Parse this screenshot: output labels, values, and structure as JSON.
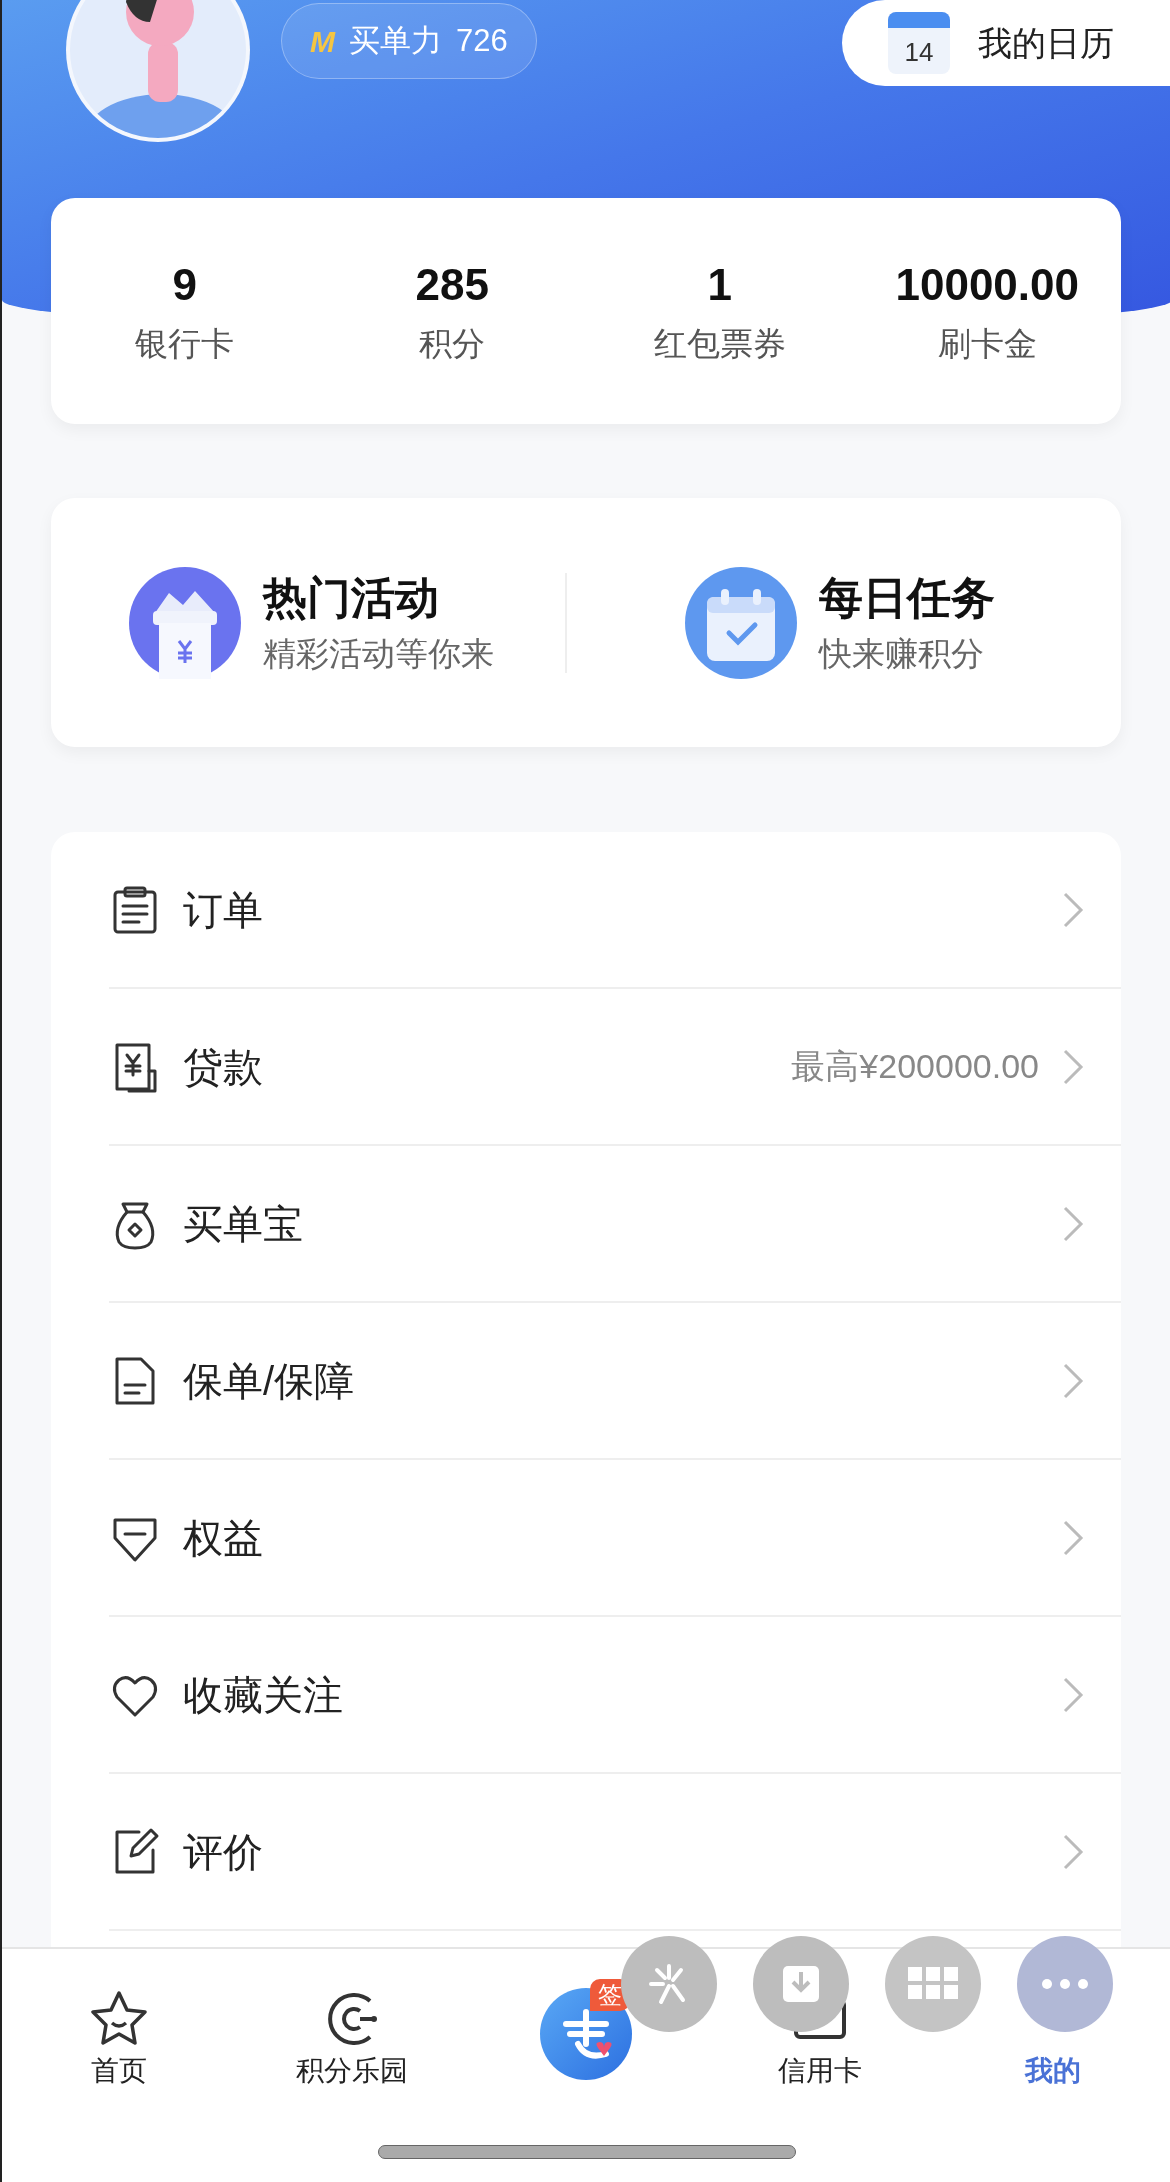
{
  "header": {
    "buy_power": {
      "logo": "M",
      "label": "买单力",
      "value": "726"
    },
    "calendar": {
      "day": "14",
      "label": "我的日历"
    }
  },
  "stats": [
    {
      "value": "9",
      "label": "银行卡"
    },
    {
      "value": "285",
      "label": "积分"
    },
    {
      "value": "1",
      "label": "红包票券"
    },
    {
      "value": "10000.00",
      "label": "刷卡金"
    }
  ],
  "activities": [
    {
      "kind": "hot",
      "title": "热门活动",
      "subtitle": "精彩活动等你来"
    },
    {
      "kind": "task",
      "title": "每日任务",
      "subtitle": "快来赚积分"
    }
  ],
  "menu": [
    {
      "kind": "order",
      "label": "订单"
    },
    {
      "kind": "loan",
      "label": "贷款",
      "note": "最高¥200000.00"
    },
    {
      "kind": "bag",
      "label": "买单宝"
    },
    {
      "kind": "doc",
      "label": "保单/保障"
    },
    {
      "kind": "gem",
      "label": "权益"
    },
    {
      "kind": "heart",
      "label": "收藏关注"
    },
    {
      "kind": "edit",
      "label": "评价"
    }
  ],
  "tab_bar": [
    {
      "kind": "home",
      "label": "首页",
      "selected": false
    },
    {
      "kind": "points",
      "label": "积分乐园",
      "selected": false
    },
    {
      "kind": "signin",
      "badge": "签",
      "selected": false
    },
    {
      "kind": "card",
      "label": "信用卡",
      "selected": false
    },
    {
      "kind": "me",
      "label": "我的",
      "selected": true
    }
  ],
  "floating_buttons": [
    {
      "kind": "spark"
    },
    {
      "kind": "download"
    },
    {
      "kind": "grid"
    },
    {
      "kind": "more"
    }
  ]
}
